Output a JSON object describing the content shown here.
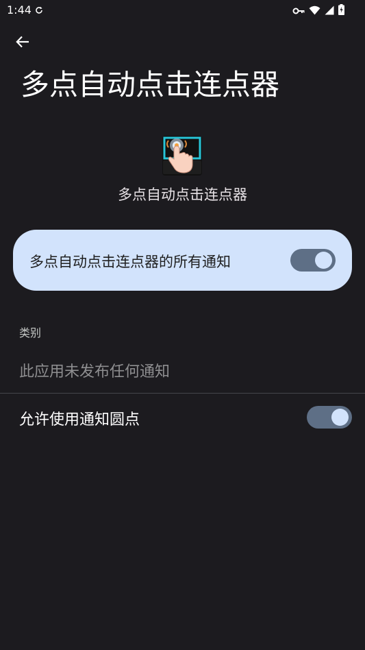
{
  "status_bar": {
    "time": "1:44",
    "icons": [
      "sync-icon",
      "vpn-key-icon",
      "wifi-icon",
      "signal-icon",
      "battery-charging-icon"
    ]
  },
  "header": {
    "title": "多点自动点击连点器"
  },
  "app": {
    "name": "多点自动点击连点器"
  },
  "master_toggle": {
    "label": "多点自动点击连点器的所有通知",
    "state": "on"
  },
  "categories": {
    "header": "类别",
    "empty_text": "此应用未发布任何通知"
  },
  "notification_dots": {
    "label": "允许使用通知圆点",
    "state": "on"
  },
  "colors": {
    "background": "#1c1b1f",
    "card": "#d2e3fc",
    "toggle_track": "#5e6f86",
    "toggle_knob": "#d2e3fc",
    "app_icon_accent": "#27c5d8"
  }
}
